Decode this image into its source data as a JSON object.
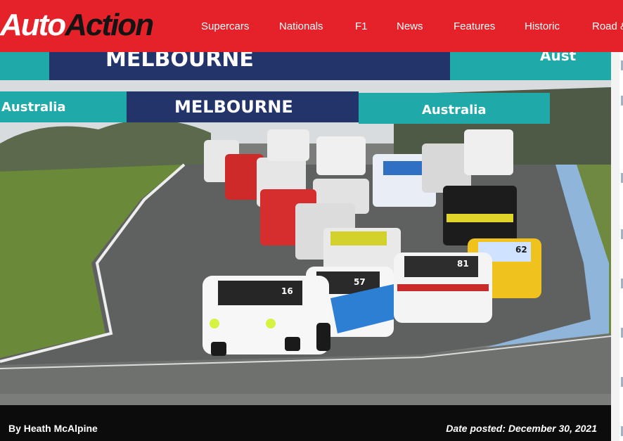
{
  "header": {
    "logo_part1": "Auto",
    "logo_part2": "Action",
    "nav": [
      "Supercars",
      "Nationals",
      "F1",
      "News",
      "Features",
      "Historic",
      "Road &"
    ]
  },
  "hero": {
    "banner_top_left": "MELBOURNE",
    "banner_top_right": "Aust",
    "banner_mid_left": "Australia",
    "banner_mid_center": "MELBOURNE",
    "banner_mid_right": "Australia",
    "lead_car_number_1": "16",
    "lead_car_number_2": "57",
    "lead_car_number_3": "81",
    "lead_car_number_4": "62"
  },
  "byline": {
    "author": "By Heath McAlpine",
    "date": "Date posted: December 30, 2021"
  },
  "colors": {
    "brand_red": "#e52229",
    "byline_bg": "#0c0c0c",
    "banner_teal": "#1fa9a8",
    "banner_navy": "#23346a"
  }
}
